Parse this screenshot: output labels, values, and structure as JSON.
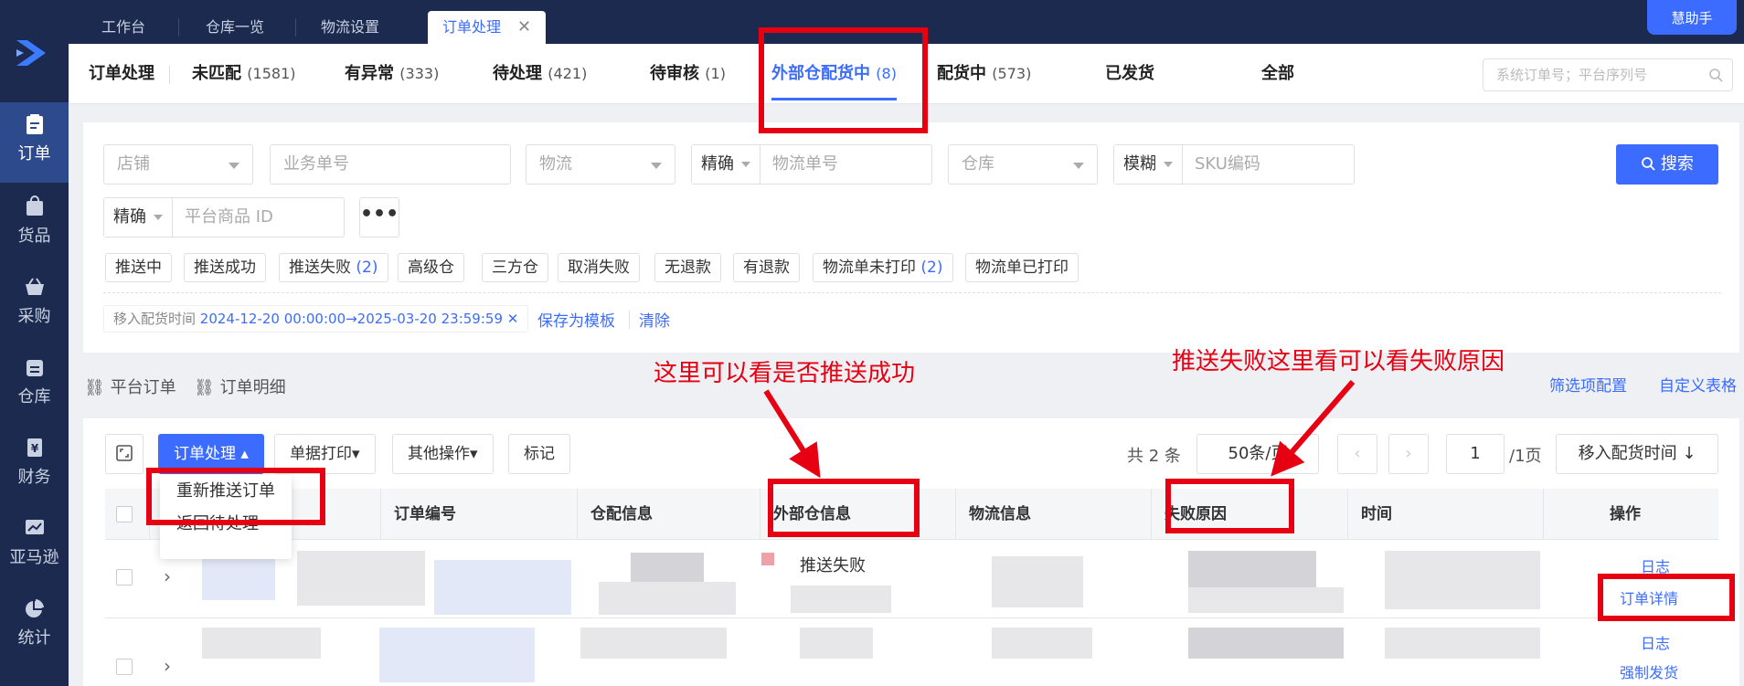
{
  "sidebar": {
    "items": [
      {
        "label": "订单",
        "icon": "clipboard-icon"
      },
      {
        "label": "货品",
        "icon": "bag-icon"
      },
      {
        "label": "采购",
        "icon": "basket-icon"
      },
      {
        "label": "仓库",
        "icon": "warehouse-icon"
      },
      {
        "label": "财务",
        "icon": "yen-icon"
      },
      {
        "label": "亚马逊",
        "icon": "chart-line-icon"
      },
      {
        "label": "统计",
        "icon": "pie-chart-icon"
      }
    ]
  },
  "top_tabs": [
    {
      "label": "工作台"
    },
    {
      "label": "仓库一览"
    },
    {
      "label": "物流设置"
    },
    {
      "label": "订单处理",
      "close": "✕"
    }
  ],
  "helper_label": "慧助手",
  "status_tabs": {
    "title": "订单处理",
    "tabs": [
      {
        "label": "未匹配",
        "count": "(1581)"
      },
      {
        "label": "有异常",
        "count": "(333)"
      },
      {
        "label": "待处理",
        "count": "(421)"
      },
      {
        "label": "待审核",
        "count": "(1)"
      },
      {
        "label": "外部仓配货中",
        "count": "(8)"
      },
      {
        "label": "配货中",
        "count": "(573)"
      },
      {
        "label": "已发货",
        "count": ""
      },
      {
        "label": "全部",
        "count": ""
      }
    ],
    "search_placeholder": "系统订单号；平台序列号"
  },
  "filters": {
    "shop": "店铺",
    "biz_no": "业务单号",
    "logistics": "物流",
    "exact": "精确",
    "tracking_no": "物流单号",
    "warehouse": "仓库",
    "fuzzy": "模糊",
    "sku": "SKU编码",
    "search_button": "搜索",
    "exact2": "精确",
    "platform_id": "平台商品 ID",
    "more": "•••",
    "tags": [
      {
        "label": "推送中",
        "count": ""
      },
      {
        "label": "推送成功",
        "count": ""
      },
      {
        "label": "推送失败",
        "count": "(2)"
      },
      {
        "label": "高级仓",
        "count": ""
      },
      {
        "label": "三方仓",
        "count": ""
      },
      {
        "label": "取消失败",
        "count": ""
      },
      {
        "label": "无退款",
        "count": ""
      },
      {
        "label": "有退款",
        "count": ""
      },
      {
        "label": "物流单未打印",
        "count": "(2)"
      },
      {
        "label": "物流单已打印",
        "count": ""
      }
    ],
    "time_label": "移入配货时间",
    "time_value": "2024-12-20 00:00:00→2025-03-20 23:59:59",
    "time_close": "✕",
    "save_template": "保存为模板",
    "clear": "清除"
  },
  "section": {
    "platform_orders": "平台订单",
    "order_details": "订单明细",
    "filter_config": "筛选项配置",
    "custom_table": "自定义表格"
  },
  "toolbar": {
    "order_process": "订单处理",
    "print": "单据打印",
    "other": "其他操作",
    "mark": "标记",
    "menu": [
      "重新推送订单",
      "返回待处理"
    ],
    "total": "共 2 条",
    "page_size": "50条/页",
    "page": "1",
    "page_total": "/1页",
    "sort": "移入配货时间 ↓"
  },
  "table": {
    "headers": [
      "订单编号",
      "仓配信息",
      "外部仓信息",
      "物流信息",
      "失败原因",
      "时间",
      "操作"
    ],
    "rows": [
      {
        "external": "推送失败",
        "ops": [
          "日志",
          "订单详情"
        ]
      },
      {
        "external": "",
        "ops": [
          "日志",
          "强制发货"
        ]
      }
    ]
  },
  "annotations": {
    "note1": "这里可以看是否推送成功",
    "note2": "推送失败这里看可以看失败原因"
  }
}
